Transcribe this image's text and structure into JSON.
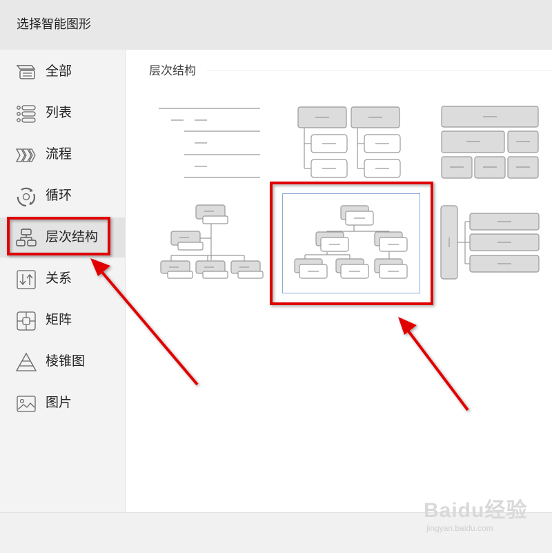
{
  "dialog": {
    "title": "选择智能图形"
  },
  "sidebar": {
    "items": [
      {
        "label": "全部",
        "icon": "all-icon"
      },
      {
        "label": "列表",
        "icon": "list-icon"
      },
      {
        "label": "流程",
        "icon": "process-icon"
      },
      {
        "label": "循环",
        "icon": "cycle-icon"
      },
      {
        "label": "层次结构",
        "icon": "hierarchy-icon",
        "selected": true
      },
      {
        "label": "关系",
        "icon": "relationship-icon"
      },
      {
        "label": "矩阵",
        "icon": "matrix-icon"
      },
      {
        "label": "棱锥图",
        "icon": "pyramid-icon"
      },
      {
        "label": "图片",
        "icon": "picture-icon"
      }
    ]
  },
  "main": {
    "section_title": "层次结构",
    "thumbnails": [
      {
        "name": "hierarchy-list",
        "selected": false
      },
      {
        "name": "table-hierarchy",
        "selected": false
      },
      {
        "name": "horizontal-hierarchy-blocks",
        "selected": false
      },
      {
        "name": "labeled-hierarchy",
        "selected": false
      },
      {
        "name": "organization-chart",
        "selected": true
      },
      {
        "name": "horizontal-bracket-list",
        "selected": false
      }
    ]
  },
  "annotations": {
    "highlight_color": "#e00000"
  },
  "watermark": {
    "brand": "Baidu经验",
    "sub": "jingyan.baidu.com"
  }
}
